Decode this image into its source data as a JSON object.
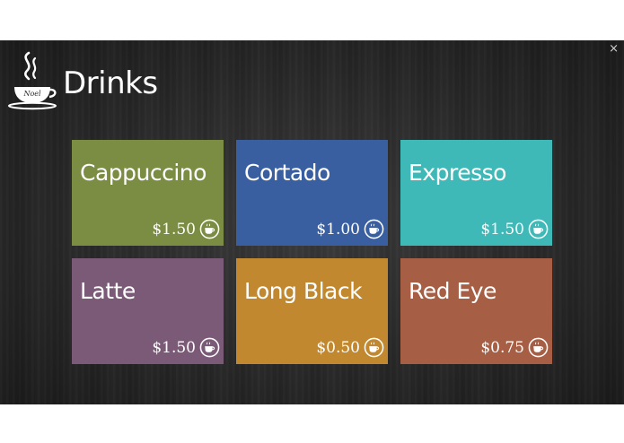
{
  "app": {
    "title": "Drinks",
    "logo_text": "Noel"
  },
  "window": {
    "close_glyph": "×"
  },
  "drinks": [
    {
      "name": "Cappuccino",
      "price": "$1.50",
      "color": "#7b8d42",
      "icon": "cup-icon"
    },
    {
      "name": "Cortado",
      "price": "$1.00",
      "color": "#3a5fa0",
      "icon": "cup-icon"
    },
    {
      "name": "Expresso",
      "price": "$1.50",
      "color": "#3fb8b8",
      "icon": "cup-icon"
    },
    {
      "name": "Latte",
      "price": "$1.50",
      "color": "#7b5a78",
      "icon": "cup-icon"
    },
    {
      "name": "Long Black",
      "price": "$0.50",
      "color": "#c1882f",
      "icon": "cup-icon"
    },
    {
      "name": "Red Eye",
      "price": "$0.75",
      "color": "#a65e45",
      "icon": "cup-icon"
    }
  ]
}
